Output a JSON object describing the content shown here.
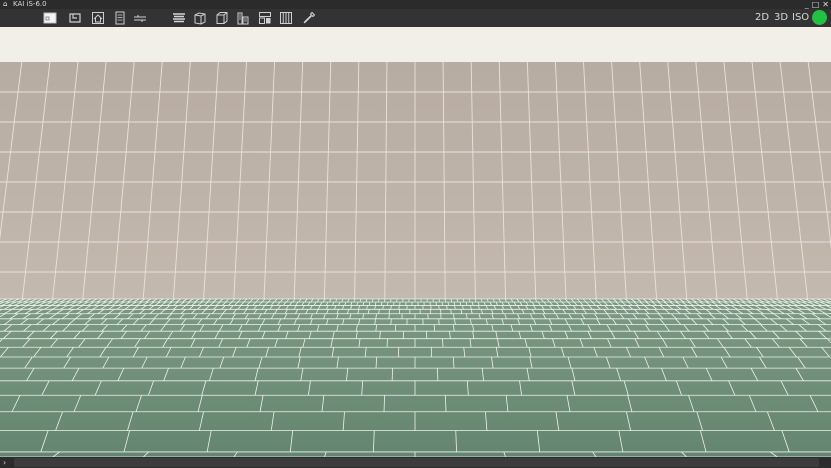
{
  "window": {
    "title": "KAI iS-6.0",
    "controls": [
      "_",
      "□",
      "✕"
    ]
  },
  "toolbar": {
    "tools": [
      {
        "name": "rectangle-tool",
        "icon": "rectangle-icon"
      },
      {
        "name": "room-tool",
        "icon": "room-icon"
      },
      {
        "name": "house-tool",
        "icon": "house-icon"
      },
      {
        "name": "document-tool",
        "icon": "document-icon"
      },
      {
        "name": "align-tool",
        "icon": "align-icon"
      },
      {
        "name": "stack-tool",
        "icon": "stack-icon"
      },
      {
        "name": "box-tool",
        "icon": "box-icon"
      },
      {
        "name": "cube-tool",
        "icon": "cube-icon"
      },
      {
        "name": "building-tool",
        "icon": "building-icon"
      },
      {
        "name": "layout-tool",
        "icon": "layout-icon"
      },
      {
        "name": "grid-tool",
        "icon": "grid-icon"
      },
      {
        "name": "eyedropper-tool",
        "icon": "eyedropper-icon"
      }
    ],
    "modes": {
      "two_d": "2D",
      "three_d": "3D",
      "iso": "ISO"
    }
  },
  "status": {
    "color": "#22c043"
  },
  "colors": {
    "wall_tile": "#b9aea4",
    "wall_grout": "#e7e2dc",
    "floor_tile": "#6a8d76",
    "floor_grout": "#eef2ea",
    "infobar": "#f1efe7"
  },
  "scrollbar": {
    "arrow": "›"
  }
}
